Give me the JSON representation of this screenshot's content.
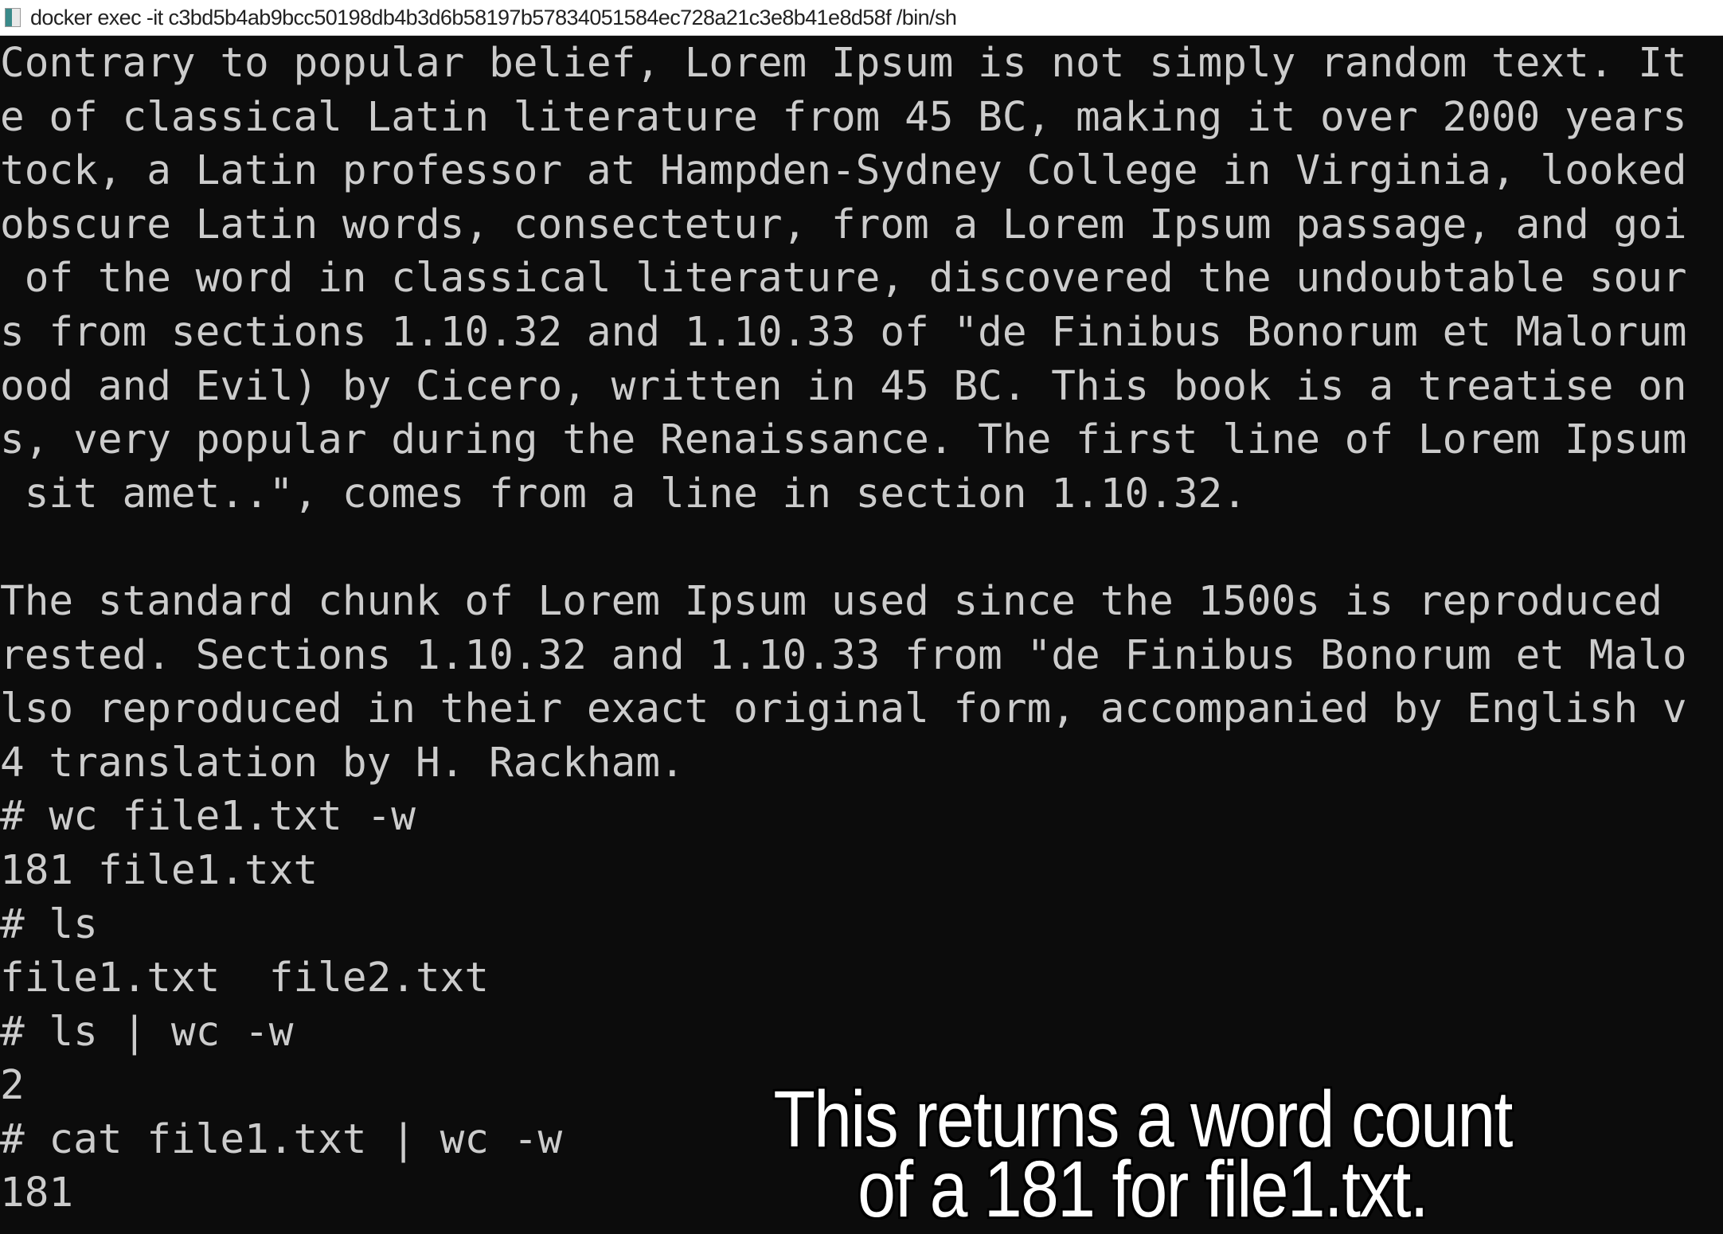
{
  "window": {
    "title": "docker  exec -it c3bd5b4ab9bcc50198db4b3d6b58197b57834051584ec728a21c3e8b41e8d58f /bin/sh"
  },
  "terminal": {
    "lines": [
      "Contrary to popular belief, Lorem Ipsum is not simply random text. It",
      "e of classical Latin literature from 45 BC, making it over 2000 years",
      "tock, a Latin professor at Hampden-Sydney College in Virginia, looked",
      "obscure Latin words, consectetur, from a Lorem Ipsum passage, and goi",
      " of the word in classical literature, discovered the undoubtable sour",
      "s from sections 1.10.32 and 1.10.33 of \"de Finibus Bonorum et Malorum",
      "ood and Evil) by Cicero, written in 45 BC. This book is a treatise on",
      "s, very popular during the Renaissance. The first line of Lorem Ipsum",
      " sit amet..\", comes from a line in section 1.10.32.",
      "",
      "The standard chunk of Lorem Ipsum used since the 1500s is reproduced ",
      "rested. Sections 1.10.32 and 1.10.33 from \"de Finibus Bonorum et Malo",
      "lso reproduced in their exact original form, accompanied by English v",
      "4 translation by H. Rackham.",
      "# wc file1.txt -w",
      "181 file1.txt",
      "# ls",
      "file1.txt  file2.txt",
      "# ls | wc -w",
      "2",
      "# cat file1.txt | wc -w",
      "181"
    ]
  },
  "caption": {
    "line1": "This returns a word count",
    "line2": "of a 181 for file1.txt."
  }
}
